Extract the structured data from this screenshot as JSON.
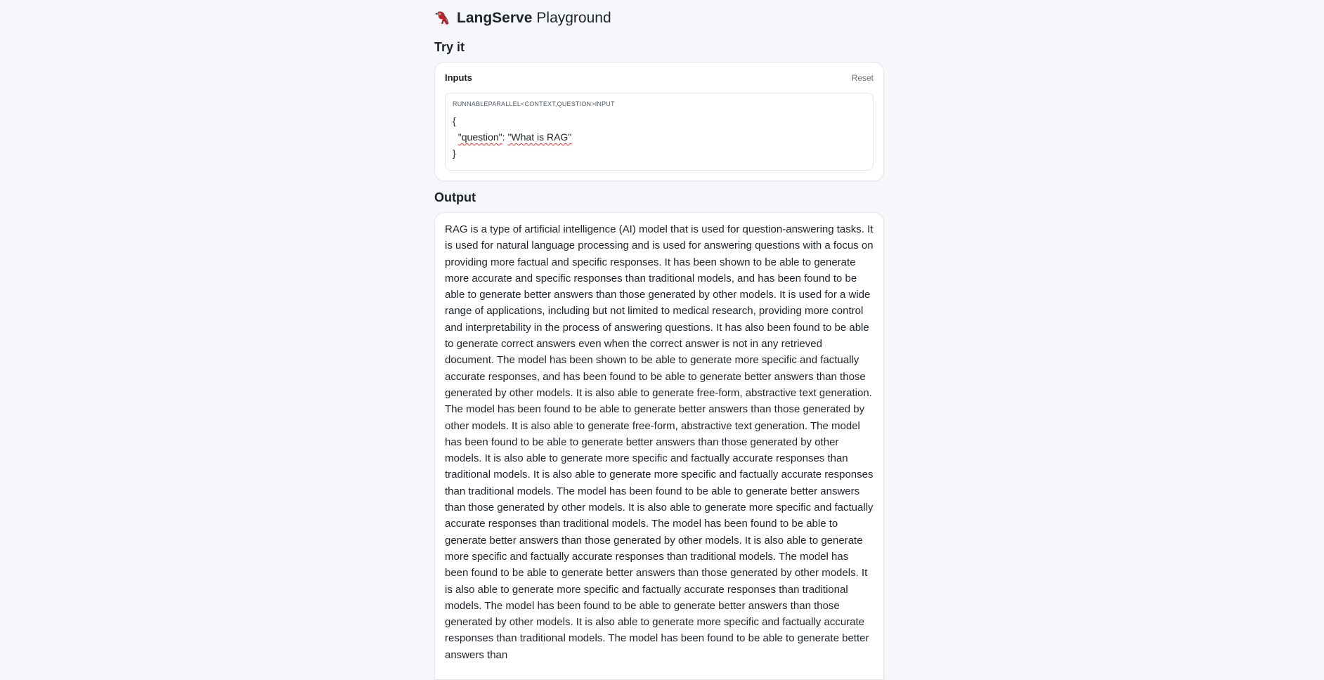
{
  "app": {
    "name_bold": "LangServe",
    "name_rest": "Playground",
    "logo": "parrot-logo-icon"
  },
  "try_it": {
    "title": "Try it",
    "inputs_label": "Inputs",
    "reset_label": "Reset",
    "schema_label": "RUNNABLEPARALLEL<CONTEXT,QUESTION>INPUT",
    "code": {
      "open_brace": "{",
      "key": "\"question\"",
      "separator": ": ",
      "value": "\"What is RAG\"",
      "close_brace": "}"
    }
  },
  "output": {
    "title": "Output",
    "text": "RAG is a type of artificial intelligence (AI) model that is used for question-answering tasks. It is used for natural language processing and is used for answering questions with a focus on providing more factual and specific responses. It has been shown to be able to generate more accurate and specific responses than traditional models, and has been found to be able to generate better answers than those generated by other models. It is used for a wide range of applications, including but not limited to medical research, providing more control and interpretability in the process of answering questions. It has also been found to be able to generate correct answers even when the correct answer is not in any retrieved document. The model has been shown to be able to generate more specific and factually accurate responses, and has been found to be able to generate better answers than those generated by other models. It is also able to generate free-form, abstractive text generation. The model has been found to be able to generate better answers than those generated by other models. It is also able to generate free-form, abstractive text generation. The model has been found to be able to generate better answers than those generated by other models. It is also able to generate more specific and factually accurate responses than traditional models. It is also able to generate more specific and factually accurate responses than traditional models. The model has been found to be able to generate better answers than those generated by other models. It is also able to generate more specific and factually accurate responses than traditional models. The model has been found to be able to generate better answers than those generated by other models. It is also able to generate more specific and factually accurate responses than traditional models. The model has been found to be able to generate better answers than those generated by other models. It is also able to generate more specific and factually accurate responses than traditional models. The model has been found to be able to generate better answers than those generated by other models. It is also able to generate more specific and factually accurate responses than traditional models. The model has been found to be able to generate better answers than"
  },
  "colors": {
    "background": "#f5f7fa",
    "card": "#ffffff",
    "logo_red": "#b7252a",
    "spell_underline": "#dd3333"
  }
}
